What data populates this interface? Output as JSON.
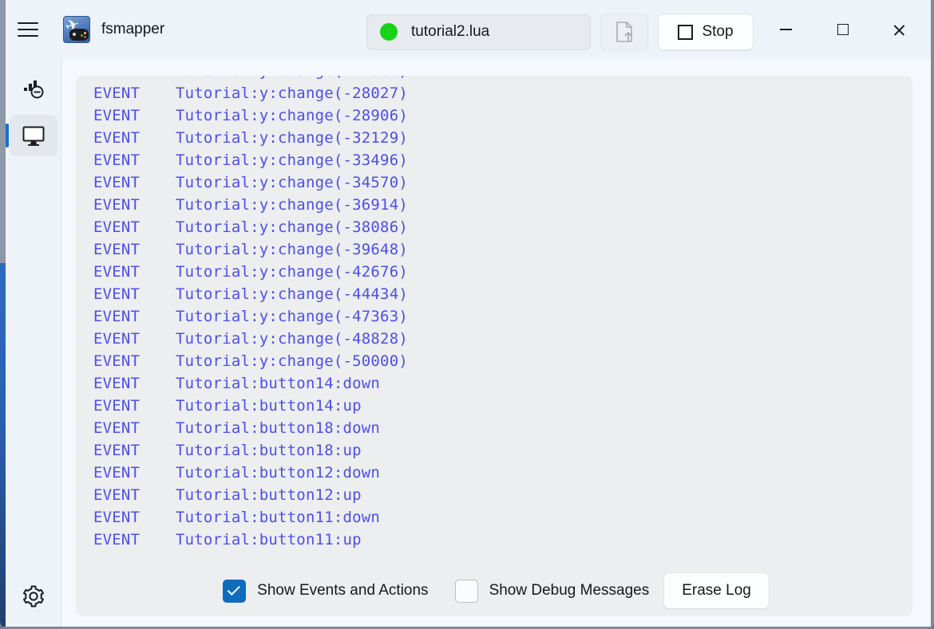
{
  "window": {
    "app_title": "fsmapper",
    "menu_icon": "hamburger-icon",
    "app_logo_icon": "fsmapper-logo-icon",
    "minimize_label": "Minimize",
    "maximize_label": "Maximize",
    "close_label": "Close"
  },
  "titlebar": {
    "script_name": "tutorial2.lua",
    "script_status": "running",
    "status_color": "#17d217",
    "load_script_icon": "document-upload-icon",
    "run_stop_label": "Stop",
    "run_stop_icon": "stop-square-icon"
  },
  "sidebar": {
    "items": [
      {
        "name": "dashboard",
        "icon": "gauge-icon",
        "selected": false
      },
      {
        "name": "console",
        "icon": "monitor-icon",
        "selected": true
      }
    ],
    "settings": {
      "name": "settings",
      "icon": "gear-icon"
    },
    "accent_color": "#1471c8"
  },
  "console": {
    "log_text_color": "#4f4fe8",
    "lines": [
      {
        "level": "EVENT",
        "message": "Tutorial:y:change(-28027)"
      },
      {
        "level": "EVENT",
        "message": "Tutorial:y:change(-28906)"
      },
      {
        "level": "EVENT",
        "message": "Tutorial:y:change(-32129)"
      },
      {
        "level": "EVENT",
        "message": "Tutorial:y:change(-33496)"
      },
      {
        "level": "EVENT",
        "message": "Tutorial:y:change(-34570)"
      },
      {
        "level": "EVENT",
        "message": "Tutorial:y:change(-36914)"
      },
      {
        "level": "EVENT",
        "message": "Tutorial:y:change(-38086)"
      },
      {
        "level": "EVENT",
        "message": "Tutorial:y:change(-39648)"
      },
      {
        "level": "EVENT",
        "message": "Tutorial:y:change(-42676)"
      },
      {
        "level": "EVENT",
        "message": "Tutorial:y:change(-44434)"
      },
      {
        "level": "EVENT",
        "message": "Tutorial:y:change(-47363)"
      },
      {
        "level": "EVENT",
        "message": "Tutorial:y:change(-48828)"
      },
      {
        "level": "EVENT",
        "message": "Tutorial:y:change(-50000)"
      },
      {
        "level": "EVENT",
        "message": "Tutorial:button14:down"
      },
      {
        "level": "EVENT",
        "message": "Tutorial:button14:up"
      },
      {
        "level": "EVENT",
        "message": "Tutorial:button18:down"
      },
      {
        "level": "EVENT",
        "message": "Tutorial:button18:up"
      },
      {
        "level": "EVENT",
        "message": "Tutorial:button12:down"
      },
      {
        "level": "EVENT",
        "message": "Tutorial:button12:up"
      },
      {
        "level": "EVENT",
        "message": "Tutorial:button11:down"
      },
      {
        "level": "EVENT",
        "message": "Tutorial:button11:up"
      }
    ],
    "controls": {
      "show_events_label": "Show Events and Actions",
      "show_events_checked": true,
      "show_debug_label": "Show Debug Messages",
      "show_debug_checked": false,
      "erase_log_label": "Erase Log",
      "checkbox_accent": "#0f6cbd"
    }
  }
}
